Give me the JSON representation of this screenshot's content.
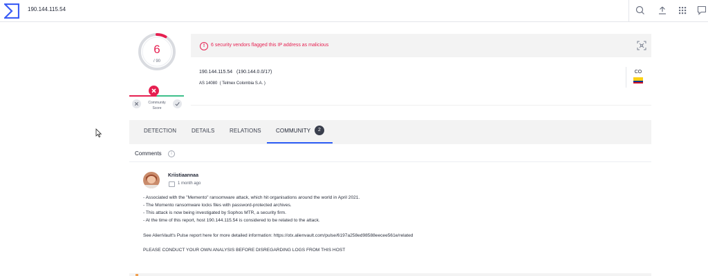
{
  "topbar": {
    "search_value": "190.144.115.54",
    "icons": [
      "search-icon",
      "upload-icon",
      "apps-grid-icon",
      "chat-icon"
    ]
  },
  "score": {
    "detections": "6",
    "total": "/ 90",
    "community_label_1": "Community",
    "community_label_2": "Score",
    "accent": "#e61f50"
  },
  "alert": {
    "text": "6 security vendors flagged this IP address as malicious"
  },
  "ip_info": {
    "ip_line": "190.144.115.54   (190.144.0.0/17)",
    "as_line": "AS 14080  ( Telmex Colombia S.A. )",
    "country_code": "CO"
  },
  "tabs": [
    {
      "label": "DETECTION"
    },
    {
      "label": "DETAILS"
    },
    {
      "label": "RELATIONS"
    },
    {
      "label": "COMMUNITY",
      "badge": "2",
      "active": true
    }
  ],
  "comments": {
    "heading": "Comments",
    "items": [
      {
        "author": "Kriistiaannaa",
        "time": "1 month ago",
        "lines": [
          "- Associated with the \"Memento\" ransomware attack, which hit organisations around the world in April 2021.",
          "- The Momento ransomware locks files with password-protected archives.",
          "- This attack is now being investigated by Sophos MTR, a security firm.",
          "- At the time of this report, host 190.144.115.54 is considered to be related to the attack.",
          "See AlienVault's Pulse report here for more detailed information: https://otx.alienvault.com/pulse/6197a258ed98588eecee561e/related",
          "PLEASE CONDUCT YOUR OWN ANALYSIS BEFORE DISREGARDING LOGS FROM THIS HOST"
        ]
      }
    ]
  }
}
